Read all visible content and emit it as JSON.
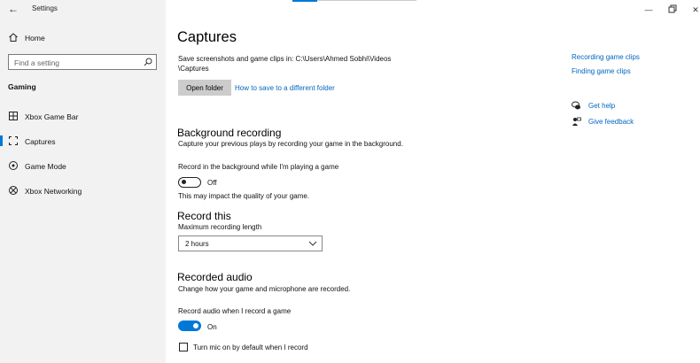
{
  "window": {
    "title": "Settings"
  },
  "sidebar": {
    "home_label": "Home",
    "search_placeholder": "Find a setting",
    "group_label": "Gaming",
    "items": [
      {
        "label": "Xbox Game Bar",
        "icon": "xbox-game-bar-icon"
      },
      {
        "label": "Captures",
        "icon": "captures-icon",
        "active": true
      },
      {
        "label": "Game Mode",
        "icon": "game-mode-icon"
      },
      {
        "label": "Xbox Networking",
        "icon": "xbox-icon"
      }
    ]
  },
  "main": {
    "title": "Captures",
    "save_path_line1": "Save screenshots and game clips in: C:\\Users\\Ahmed Sobhi\\Videos",
    "save_path_line2": "\\Captures",
    "open_folder_label": "Open folder",
    "how_to_save_link": "How to save to a different folder",
    "background_recording": {
      "heading": "Background recording",
      "description": "Capture your previous plays by recording your game in the background.",
      "toggle_label": "Record in the background while I'm playing a game",
      "toggle_state": "Off",
      "note": "This may impact the quality of your game."
    },
    "record_this": {
      "heading": "Record this",
      "max_length_label": "Maximum recording length",
      "max_length_value": "2 hours"
    },
    "recorded_audio": {
      "heading": "Recorded audio",
      "description": "Change how your game and microphone are recorded.",
      "toggle_label": "Record audio when I record a game",
      "toggle_state": "On",
      "mic_checkbox_label": "Turn mic on by default when I record"
    }
  },
  "right_panel": {
    "links": [
      "Recording game clips",
      "Finding game clips"
    ],
    "get_help": "Get help",
    "give_feedback": "Give feedback"
  },
  "colors": {
    "accent": "#0078d7",
    "link": "#0067c0",
    "sidebar_bg": "#f2f2f2"
  }
}
